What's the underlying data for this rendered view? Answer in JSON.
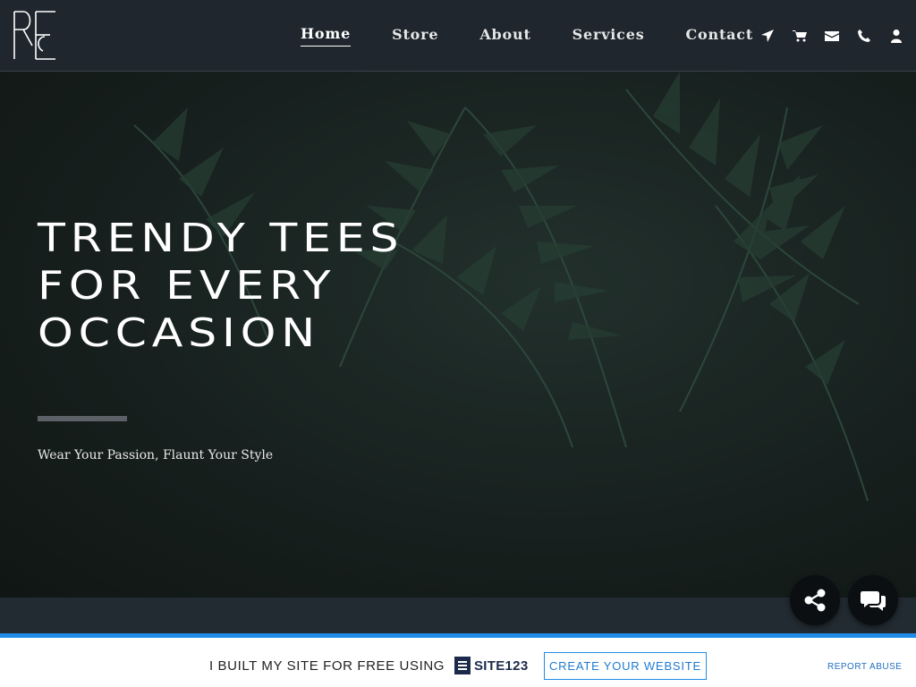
{
  "nav": {
    "items": [
      {
        "label": "Home",
        "active": true
      },
      {
        "label": "Store",
        "active": false
      },
      {
        "label": "About",
        "active": false
      },
      {
        "label": "Services",
        "active": false
      },
      {
        "label": "Contact",
        "active": false
      }
    ],
    "icons": [
      "location-arrow-icon",
      "cart-icon",
      "envelope-icon",
      "phone-icon",
      "user-icon"
    ]
  },
  "hero": {
    "title": "TRENDY TEES FOR EVERY OCCASION",
    "subtitle": "Wear Your Passion, Flaunt Your Style"
  },
  "floating": {
    "share_icon": "share-icon",
    "chat_icon": "chat-icon"
  },
  "footer": {
    "built_text": "I BUILT MY SITE FOR FREE USING",
    "brand": "SITE123",
    "create_label": "CREATE YOUR WEBSITE",
    "report_label": "REPORT ABUSE"
  },
  "colors": {
    "header_bg": "#1f262d",
    "accent_blue": "#1f8ce6",
    "hero_text": "#ffffff",
    "fab_bg": "#0c0f12"
  }
}
